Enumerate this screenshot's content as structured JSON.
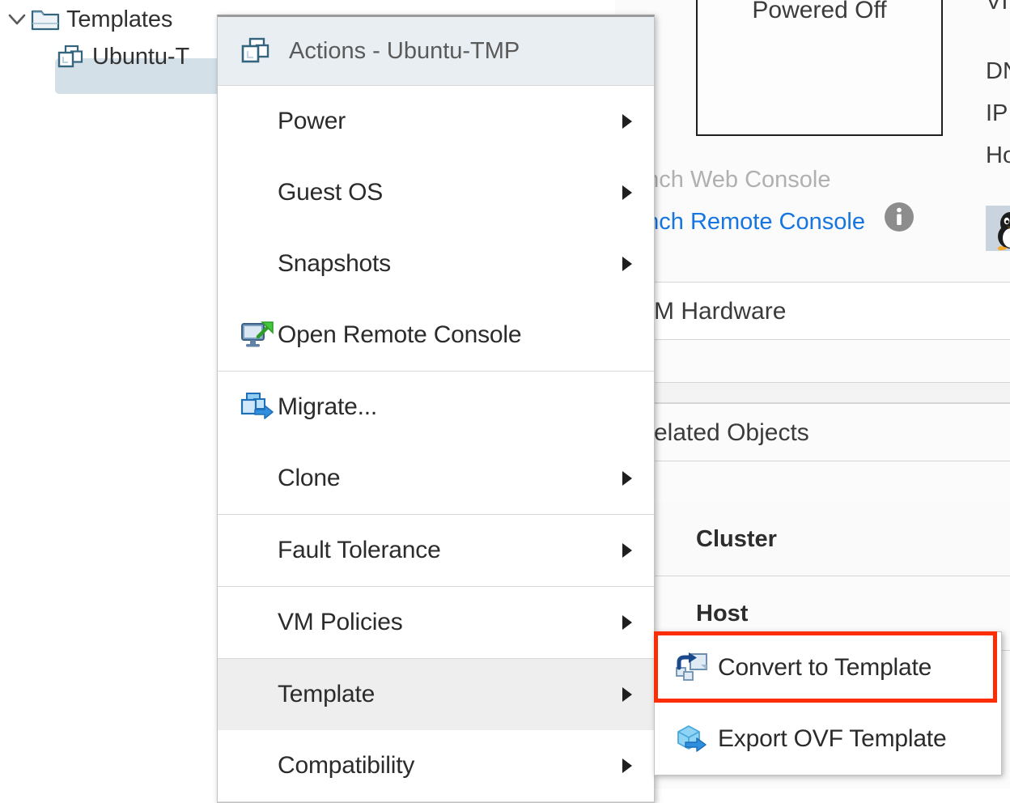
{
  "tree": {
    "items": [
      {
        "label": "Templates",
        "icon": "folder-icon",
        "expanded": true,
        "level": 0,
        "selected": false
      },
      {
        "label": "Ubuntu-T",
        "icon": "vm-template-icon",
        "expanded": false,
        "level": 1,
        "selected": true
      }
    ],
    "templates_label": "Templates",
    "vm_label": "Ubuntu-T"
  },
  "context_menu": {
    "header": {
      "title": "Actions - Ubuntu-TMP",
      "icon": "vm-template-icon"
    },
    "items": [
      {
        "label": "Power",
        "icon": null,
        "submenu": true,
        "highlighted": false
      },
      {
        "label": "Guest OS",
        "icon": null,
        "submenu": true,
        "highlighted": false
      },
      {
        "label": "Snapshots",
        "icon": null,
        "submenu": true,
        "highlighted": false
      },
      {
        "label": "Open Remote Console",
        "icon": "remote-console-icon",
        "submenu": false,
        "highlighted": false
      },
      {
        "label": "Migrate...",
        "icon": "migrate-icon",
        "submenu": false,
        "highlighted": false
      },
      {
        "label": "Clone",
        "icon": null,
        "submenu": true,
        "highlighted": false
      },
      {
        "label": "Fault Tolerance",
        "icon": null,
        "submenu": true,
        "highlighted": false
      },
      {
        "label": "VM Policies",
        "icon": null,
        "submenu": true,
        "highlighted": false
      },
      {
        "label": "Template",
        "icon": null,
        "submenu": true,
        "highlighted": true
      },
      {
        "label": "Compatibility",
        "icon": null,
        "submenu": true,
        "highlighted": false
      }
    ],
    "labels": {
      "power": "Power",
      "guest_os": "Guest OS",
      "snapshots": "Snapshots",
      "open_remote_console": "Open Remote Console",
      "migrate": "Migrate...",
      "clone": "Clone",
      "fault_tolerance": "Fault Tolerance",
      "vm_policies": "VM Policies",
      "template": "Template",
      "compatibility": "Compatibility"
    }
  },
  "submenu": {
    "parent": "Template",
    "items": [
      {
        "label": "Convert to Template",
        "icon": "convert-to-template-icon",
        "highlighted": true
      },
      {
        "label": "Export OVF Template",
        "icon": "export-ovf-icon",
        "highlighted": false
      }
    ],
    "labels": {
      "convert_to_template": "Convert to Template",
      "export_ovf_template": "Export OVF Template"
    }
  },
  "annotation": {
    "color": "#fc2c04",
    "target": "Convert to Template"
  },
  "details_panel": {
    "power_state": "Powered Off",
    "launch_web_console": "unch Web Console",
    "launch_remote_console": "unch Remote Console",
    "info_icon": "info-icon",
    "guest_os_icon": "linux-penguin-icon",
    "right_labels": [
      "VI",
      "DN",
      "IP",
      "Ho"
    ],
    "sections": [
      {
        "title": "M Hardware"
      },
      {
        "title": "elated Objects"
      }
    ],
    "section_vm_hardware": "M Hardware",
    "section_related_objects": "elated Objects",
    "related_objects_rows": [
      {
        "key": "Cluster"
      },
      {
        "key": "Host"
      }
    ],
    "row_cluster": "Cluster",
    "row_host": "Host"
  },
  "colors": {
    "accent_link": "#1675e0",
    "annotation_red": "#fc2c04",
    "menu_header_bg": "#e9eef2",
    "menu_highlight_bg": "#eeeeee",
    "tree_selection_bg": "#d3e0e8",
    "vm_icon_blue": "#35647e"
  }
}
